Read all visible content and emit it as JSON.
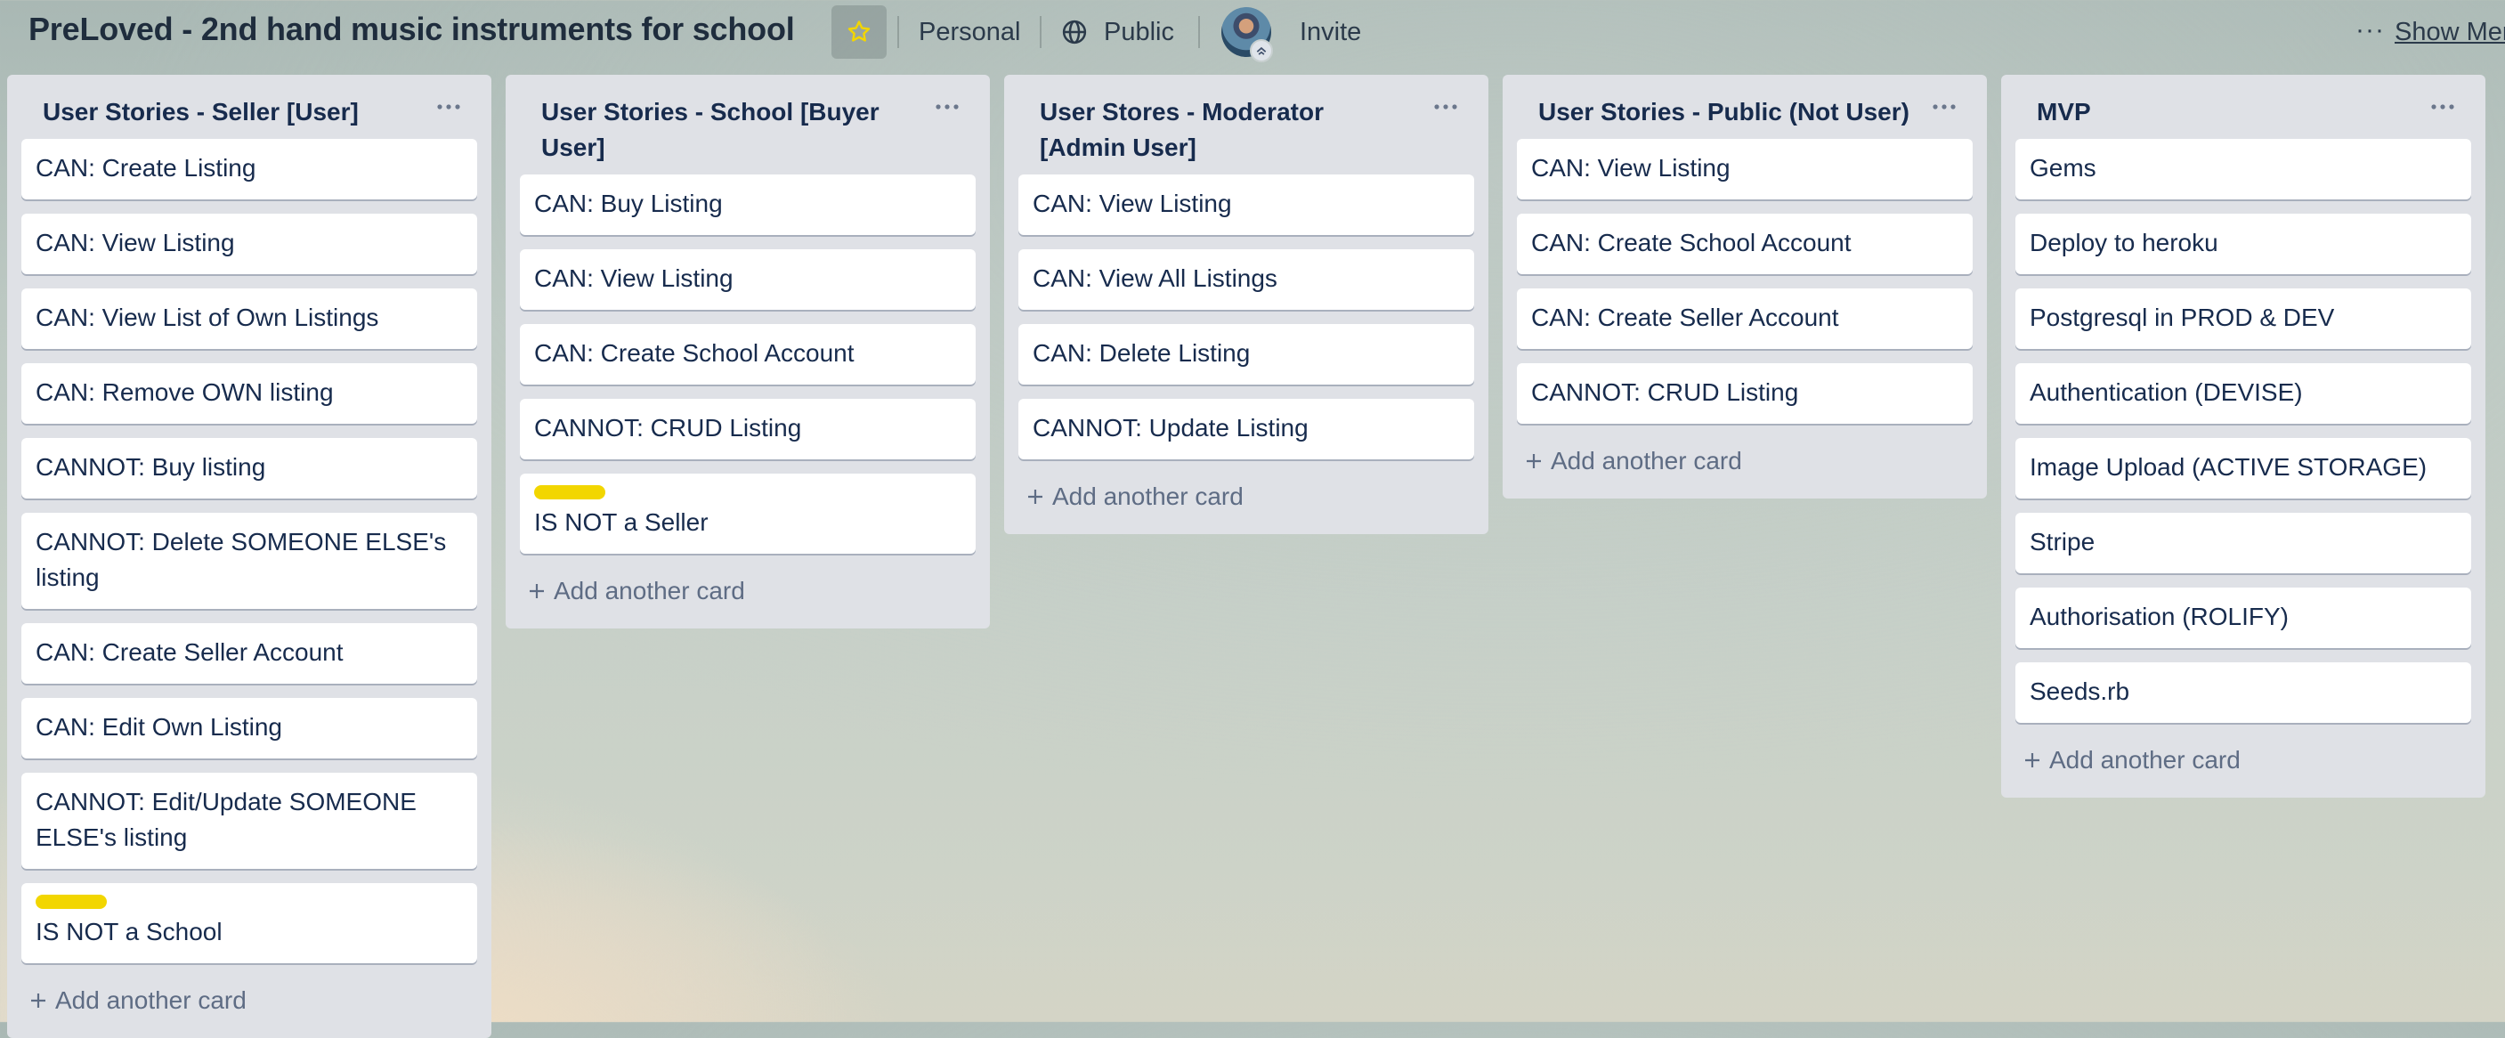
{
  "header": {
    "board_title": "PreLoved - 2nd hand music instruments for school",
    "star_icon": "star-icon",
    "team_label": "Personal",
    "visibility_label": "Public",
    "invite_label": "Invite",
    "more_icon": "ellipsis-icon",
    "show_menu_label": "Show Menu"
  },
  "lists": [
    {
      "title": "User Stories - Seller [User]",
      "add_card_label": "Add another card",
      "cards": [
        {
          "text": "CAN: Create Listing"
        },
        {
          "text": "CAN: View Listing"
        },
        {
          "text": "CAN: View List of Own Listings"
        },
        {
          "text": "CAN: Remove OWN listing"
        },
        {
          "text": "CANNOT: Buy listing"
        },
        {
          "text": "CANNOT: Delete SOMEONE ELSE's listing"
        },
        {
          "text": "CAN: Create Seller Account"
        },
        {
          "text": "CAN: Edit Own Listing"
        },
        {
          "text": "CANNOT: Edit/Update SOMEONE ELSE's listing"
        },
        {
          "text": "IS NOT a School",
          "label_color": "#f2d600"
        }
      ]
    },
    {
      "title": "User Stories - School [Buyer User]",
      "add_card_label": "Add another card",
      "cards": [
        {
          "text": "CAN: Buy Listing"
        },
        {
          "text": "CAN: View Listing"
        },
        {
          "text": "CAN: Create School Account"
        },
        {
          "text": "CANNOT: CRUD Listing"
        },
        {
          "text": "IS NOT a Seller",
          "label_color": "#f2d600"
        }
      ]
    },
    {
      "title": "User Stores - Moderator [Admin User]",
      "add_card_label": "Add another card",
      "cards": [
        {
          "text": "CAN: View Listing"
        },
        {
          "text": "CAN: View All Listings"
        },
        {
          "text": "CAN: Delete Listing"
        },
        {
          "text": "CANNOT: Update Listing"
        }
      ]
    },
    {
      "title": "User Stories - Public (Not User)",
      "add_card_label": "Add another card",
      "cards": [
        {
          "text": "CAN: View Listing"
        },
        {
          "text": "CAN: Create School Account"
        },
        {
          "text": "CAN: Create Seller Account"
        },
        {
          "text": "CANNOT: CRUD Listing"
        }
      ]
    },
    {
      "title": "MVP",
      "add_card_label": "Add another card",
      "cards": [
        {
          "text": "Gems"
        },
        {
          "text": "Deploy to heroku"
        },
        {
          "text": "Postgresql in PROD & DEV"
        },
        {
          "text": "Authentication (DEVISE)"
        },
        {
          "text": "Image Upload (ACTIVE STORAGE)"
        },
        {
          "text": "Stripe"
        },
        {
          "text": "Authorisation (ROLIFY)"
        },
        {
          "text": "Seeds.rb"
        }
      ]
    }
  ]
}
